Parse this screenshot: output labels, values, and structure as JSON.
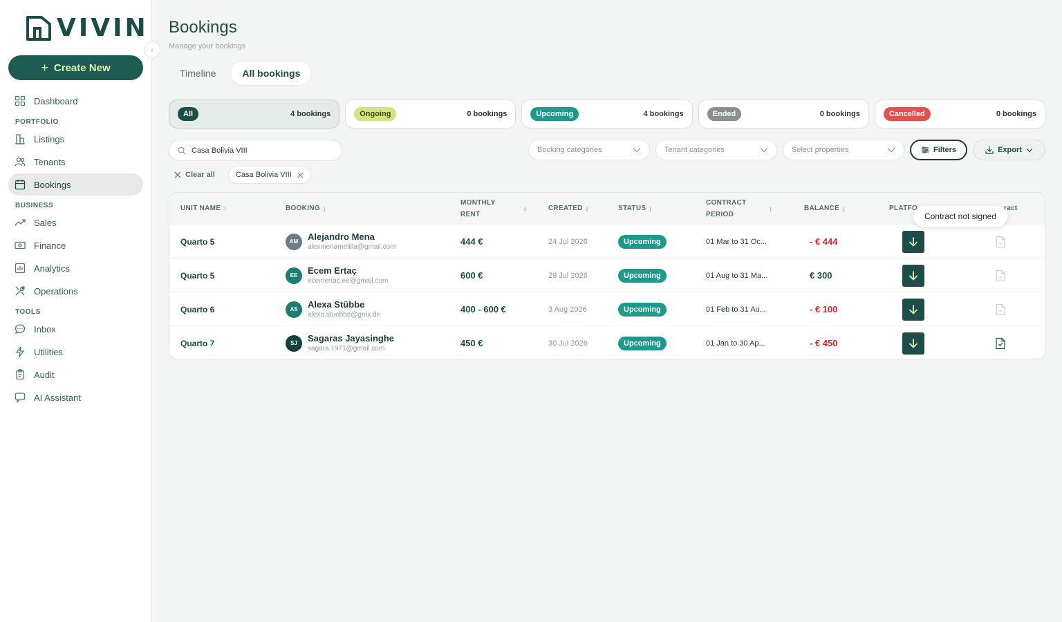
{
  "brand": {
    "name": "VIVIN"
  },
  "sidebar": {
    "create_label": "Create New",
    "sections": {
      "portfolio": "PORTFOLIO",
      "business": "BUSINESS",
      "tools": "TOOLS"
    },
    "items": {
      "dashboard": "Dashboard",
      "listings": "Listings",
      "tenants": "Tenants",
      "bookings": "Bookings",
      "sales": "Sales",
      "finance": "Finance",
      "analytics": "Analytics",
      "operations": "Operations",
      "inbox": "Inbox",
      "utilities": "Utilities",
      "audit": "Audit",
      "ai_assistant": "AI Assistant"
    },
    "active": "Bookings"
  },
  "header": {
    "title": "Bookings",
    "subtitle": "Manage your bookings"
  },
  "tabs": {
    "timeline": "Timeline",
    "all_bookings": "All bookings",
    "active": "All bookings"
  },
  "status_cards": [
    {
      "label": "All",
      "count": "4 bookings",
      "bg": "#1d4d48",
      "fg": "#ffffff"
    },
    {
      "label": "Ongoing",
      "count": "0 bookings",
      "bg": "#d4e37f",
      "fg": "#3b4a13"
    },
    {
      "label": "Upcoming",
      "count": "4 bookings",
      "bg": "#1e9a8c",
      "fg": "#ffffff"
    },
    {
      "label": "Ended",
      "count": "0 bookings",
      "bg": "#8a8f8f",
      "fg": "#ffffff"
    },
    {
      "label": "Cancelled",
      "count": "0 bookings",
      "bg": "#e4504f",
      "fg": "#ffffff"
    }
  ],
  "filters": {
    "search_value": "Casa Bolivia VIII",
    "booking_categories": "Booking categories",
    "tenant_categories": "Tenant categories",
    "select_properties": "Select properties",
    "filters_label": "Filters",
    "export_label": "Export",
    "clear_all": "Clear all",
    "active_chip": "Casa Bolivia VIII"
  },
  "table": {
    "columns": {
      "unit_name": "UNIT NAME",
      "booking": "BOOKING",
      "monthly_rent_1": "MONTHLY",
      "monthly_rent_2": "RENT",
      "created": "CREATED",
      "status": "STATUS",
      "contract_period_1": "CONTRACT",
      "contract_period_2": "PERIOD",
      "balance": "BALANCE",
      "platform": "PLATFO",
      "contract": "ract"
    },
    "rows": [
      {
        "unit": "Quarto 5",
        "initials": "AM",
        "avatar_color": "#6b7d86",
        "name": "Alejandro Mena",
        "email": "alexmenamelilla@gmail.com",
        "rent": "444 €",
        "created": "24 Jul 2026",
        "status": "Upcoming",
        "period": "01 Mar to 31 Oc...",
        "balance": "- € 444",
        "balance_color": "#d6262a",
        "contract_signed": false
      },
      {
        "unit": "Quarto 5",
        "initials": "EE",
        "avatar_color": "#1e7d72",
        "name": "Ecem Ertaç",
        "email": "ecemertac.ee@gmail.com",
        "rent": "600 €",
        "created": "29 Jul 2026",
        "status": "Upcoming",
        "period": "01 Aug to 31 Ma...",
        "balance": "€ 300",
        "balance_color": "#1d4d48",
        "contract_signed": false
      },
      {
        "unit": "Quarto 6",
        "initials": "AS",
        "avatar_color": "#1e7d72",
        "name": "Alexa Stübbe",
        "email": "alexa.stuebbe@gmx.de",
        "rent": "400 - 600 €",
        "created": "3 Aug 2026",
        "status": "Upcoming",
        "period": "01 Feb to 31 Au...",
        "balance": "- € 100",
        "balance_color": "#d6262a",
        "contract_signed": false
      },
      {
        "unit": "Quarto 7",
        "initials": "SJ",
        "avatar_color": "#15423d",
        "name": "Sagaras Jayasinghe",
        "email": "sagara.1971@gmail.com",
        "rent": "450 €",
        "created": "30 Jul 2026",
        "status": "Upcoming",
        "period": "01 Jan to 30 Ap...",
        "balance": "- € 450",
        "balance_color": "#d6262a",
        "contract_signed": true
      }
    ]
  },
  "tooltip": "Contract not signed"
}
